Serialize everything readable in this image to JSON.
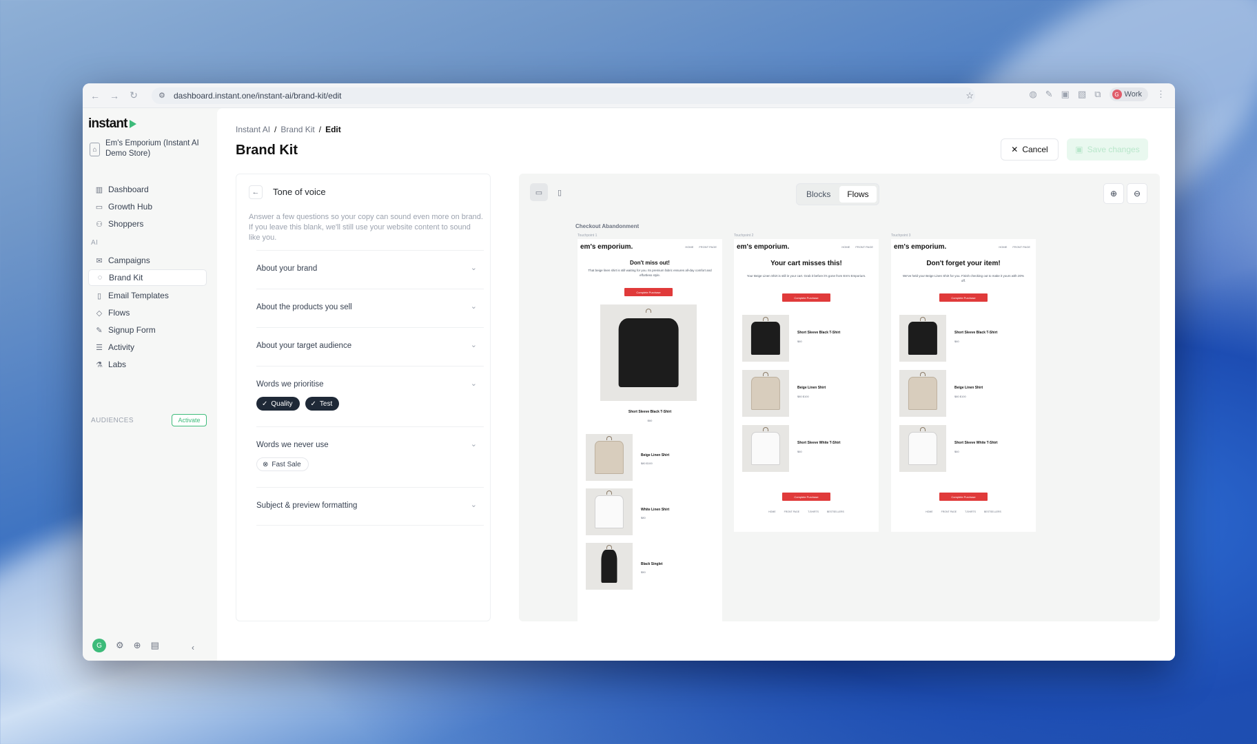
{
  "browser": {
    "url": "dashboard.instant.one/instant-ai/brand-kit/edit",
    "profile_label": "Work",
    "profile_initial": "G"
  },
  "sidebar": {
    "logo": "instant",
    "store_name": "Em's Emporium (Instant AI Demo Store)",
    "nav_top": [
      {
        "label": "Dashboard",
        "icon": "bar-chart-icon"
      },
      {
        "label": "Growth Hub",
        "icon": "chat-icon"
      },
      {
        "label": "Shoppers",
        "icon": "users-icon"
      }
    ],
    "ai_section_label": "AI",
    "nav_ai": [
      {
        "label": "Campaigns",
        "icon": "mail-icon"
      },
      {
        "label": "Brand Kit",
        "icon": "palette-icon",
        "active": true
      },
      {
        "label": "Email Templates",
        "icon": "columns-icon"
      },
      {
        "label": "Flows",
        "icon": "flow-icon"
      },
      {
        "label": "Signup Form",
        "icon": "edit-icon"
      },
      {
        "label": "Activity",
        "icon": "list-icon"
      },
      {
        "label": "Labs",
        "icon": "flask-icon"
      }
    ],
    "audiences_label": "AUDIENCES",
    "activate_label": "Activate",
    "user_initial": "G"
  },
  "header": {
    "breadcrumb": [
      "Instant AI",
      "Brand Kit",
      "Edit"
    ],
    "title": "Brand Kit",
    "cancel_label": "Cancel",
    "save_label": "Save changes"
  },
  "tone_panel": {
    "title": "Tone of voice",
    "description": "Answer a few questions so your copy can sound even more on brand. If you leave this blank, we'll still use your website content to sound like you.",
    "sections": [
      {
        "label": "About your brand"
      },
      {
        "label": "About the products you sell"
      },
      {
        "label": "About your target audience"
      },
      {
        "label": "Words we prioritise",
        "chips": [
          "Quality",
          "Test"
        ]
      },
      {
        "label": "Words we never use",
        "chips": [
          "Fast Sale"
        ]
      },
      {
        "label": "Subject & preview formatting"
      }
    ]
  },
  "preview": {
    "tabs": [
      "Blocks",
      "Flows"
    ],
    "active_tab": "Flows",
    "flow_title": "Checkout Abandonment",
    "touchpoints": [
      {
        "label": "Touchpoint 1",
        "brand": "em's emporium.",
        "nav": [
          "HOME",
          "FRONT PAGE"
        ],
        "heading": "Don't miss out!",
        "body": "That beige linen shirt is still waiting for you. Its premium fabric ensures all-day comfort and effortless style.",
        "cta": "Complete Purchase",
        "hero_name": "Short Sleeve Black T-Shirt",
        "hero_price": "$60",
        "products": [
          {
            "name": "Beige Linen Shirt",
            "price": "$80  $100"
          },
          {
            "name": "White Linen Shirt",
            "price": "$80"
          },
          {
            "name": "Black Singlet",
            "price": "$50"
          }
        ]
      },
      {
        "label": "Touchpoint 2",
        "brand": "em's emporium.",
        "nav": [
          "HOME",
          "FRONT PAGE"
        ],
        "heading": "Your cart misses this!",
        "body": "Your Beige Linen Shirt is still in your cart. Grab it before it's gone from Em's Emporium.",
        "cta": "Complete Purchase",
        "products": [
          {
            "name": "Short Sleeve Black T-Shirt",
            "price": "$60"
          },
          {
            "name": "Beige Linen Shirt",
            "price": "$80  $100"
          },
          {
            "name": "Short Sleeve White T-Shirt",
            "price": "$60"
          }
        ],
        "cta_bottom": "Complete Purchase",
        "footer_links": [
          "HOME",
          "FRONT PAGE",
          "T-SHIRTS",
          "BESTSELLERS"
        ]
      },
      {
        "label": "Touchpoint 3",
        "brand": "em's emporium.",
        "nav": [
          "HOME",
          "FRONT PAGE"
        ],
        "heading": "Don't forget your item!",
        "body": "We've held your Beige Linen Shirt for you. Finish checking out to make it yours with 20% off.",
        "cta": "Complete Purchase",
        "products": [
          {
            "name": "Short Sleeve Black T-Shirt",
            "price": "$60"
          },
          {
            "name": "Beige Linen Shirt",
            "price": "$80  $100"
          },
          {
            "name": "Short Sleeve White T-Shirt",
            "price": "$60"
          }
        ],
        "cta_bottom": "Complete Purchase",
        "footer_links": [
          "HOME",
          "FRONT PAGE",
          "T-SHIRTS",
          "BESTSELLERS"
        ]
      }
    ]
  },
  "colors": {
    "accent_green": "#3dbb7a",
    "cta_red": "#e03a3a",
    "chip_dark": "#1f2937"
  }
}
